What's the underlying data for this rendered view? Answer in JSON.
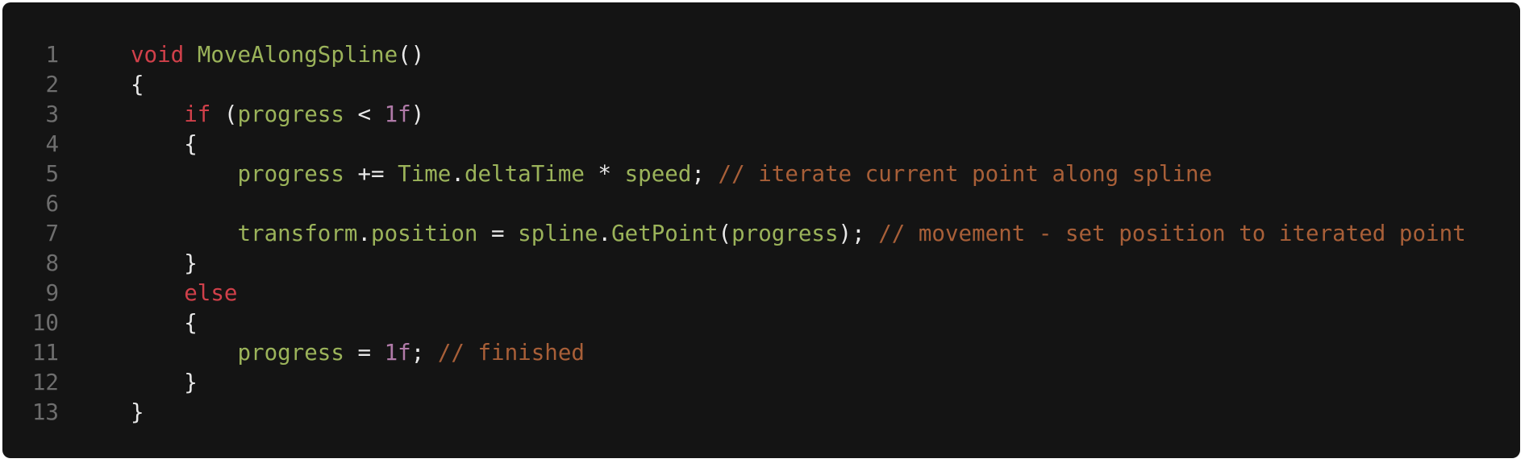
{
  "colors": {
    "background": "#141414",
    "keyword": "#d0404a",
    "identifier": "#9bb35a",
    "number": "#b07aa8",
    "comment": "#a85f38",
    "punctuation": "#e8e8e8",
    "line_number": "#6e6e6e"
  },
  "code": {
    "lines": [
      {
        "n": "1",
        "tokens": [
          {
            "t": "void",
            "c": "keyword"
          },
          {
            "t": " ",
            "c": "punctuation"
          },
          {
            "t": "MoveAlongSpline",
            "c": "identifier"
          },
          {
            "t": "()",
            "c": "punctuation"
          }
        ]
      },
      {
        "n": "2",
        "tokens": [
          {
            "t": "{",
            "c": "punctuation"
          }
        ]
      },
      {
        "n": "3",
        "tokens": [
          {
            "t": "    ",
            "c": "punctuation"
          },
          {
            "t": "if",
            "c": "keyword"
          },
          {
            "t": " (",
            "c": "punctuation"
          },
          {
            "t": "progress",
            "c": "identifier"
          },
          {
            "t": " < ",
            "c": "punctuation"
          },
          {
            "t": "1f",
            "c": "number"
          },
          {
            "t": ")",
            "c": "punctuation"
          }
        ]
      },
      {
        "n": "4",
        "tokens": [
          {
            "t": "    {",
            "c": "punctuation"
          }
        ]
      },
      {
        "n": "5",
        "tokens": [
          {
            "t": "        ",
            "c": "punctuation"
          },
          {
            "t": "progress",
            "c": "identifier"
          },
          {
            "t": " += ",
            "c": "punctuation"
          },
          {
            "t": "Time",
            "c": "identifier"
          },
          {
            "t": ".",
            "c": "punctuation"
          },
          {
            "t": "deltaTime",
            "c": "identifier"
          },
          {
            "t": " * ",
            "c": "punctuation"
          },
          {
            "t": "speed",
            "c": "identifier"
          },
          {
            "t": "; ",
            "c": "punctuation"
          },
          {
            "t": "// iterate current point along spline",
            "c": "comment"
          }
        ]
      },
      {
        "n": "6",
        "tokens": []
      },
      {
        "n": "7",
        "tokens": [
          {
            "t": "        ",
            "c": "punctuation"
          },
          {
            "t": "transform",
            "c": "identifier"
          },
          {
            "t": ".",
            "c": "punctuation"
          },
          {
            "t": "position",
            "c": "identifier"
          },
          {
            "t": " = ",
            "c": "punctuation"
          },
          {
            "t": "spline",
            "c": "identifier"
          },
          {
            "t": ".",
            "c": "punctuation"
          },
          {
            "t": "GetPoint",
            "c": "identifier"
          },
          {
            "t": "(",
            "c": "punctuation"
          },
          {
            "t": "progress",
            "c": "identifier"
          },
          {
            "t": "); ",
            "c": "punctuation"
          },
          {
            "t": "// movement - set position to iterated point",
            "c": "comment"
          }
        ]
      },
      {
        "n": "8",
        "tokens": [
          {
            "t": "    }",
            "c": "punctuation"
          }
        ]
      },
      {
        "n": "9",
        "tokens": [
          {
            "t": "    ",
            "c": "punctuation"
          },
          {
            "t": "else",
            "c": "keyword"
          }
        ]
      },
      {
        "n": "10",
        "tokens": [
          {
            "t": "    {",
            "c": "punctuation"
          }
        ]
      },
      {
        "n": "11",
        "tokens": [
          {
            "t": "        ",
            "c": "punctuation"
          },
          {
            "t": "progress",
            "c": "identifier"
          },
          {
            "t": " = ",
            "c": "punctuation"
          },
          {
            "t": "1f",
            "c": "number"
          },
          {
            "t": "; ",
            "c": "punctuation"
          },
          {
            "t": "// finished",
            "c": "comment"
          }
        ]
      },
      {
        "n": "12",
        "tokens": [
          {
            "t": "    }",
            "c": "punctuation"
          }
        ]
      },
      {
        "n": "13",
        "tokens": [
          {
            "t": "}",
            "c": "punctuation"
          }
        ]
      }
    ]
  }
}
